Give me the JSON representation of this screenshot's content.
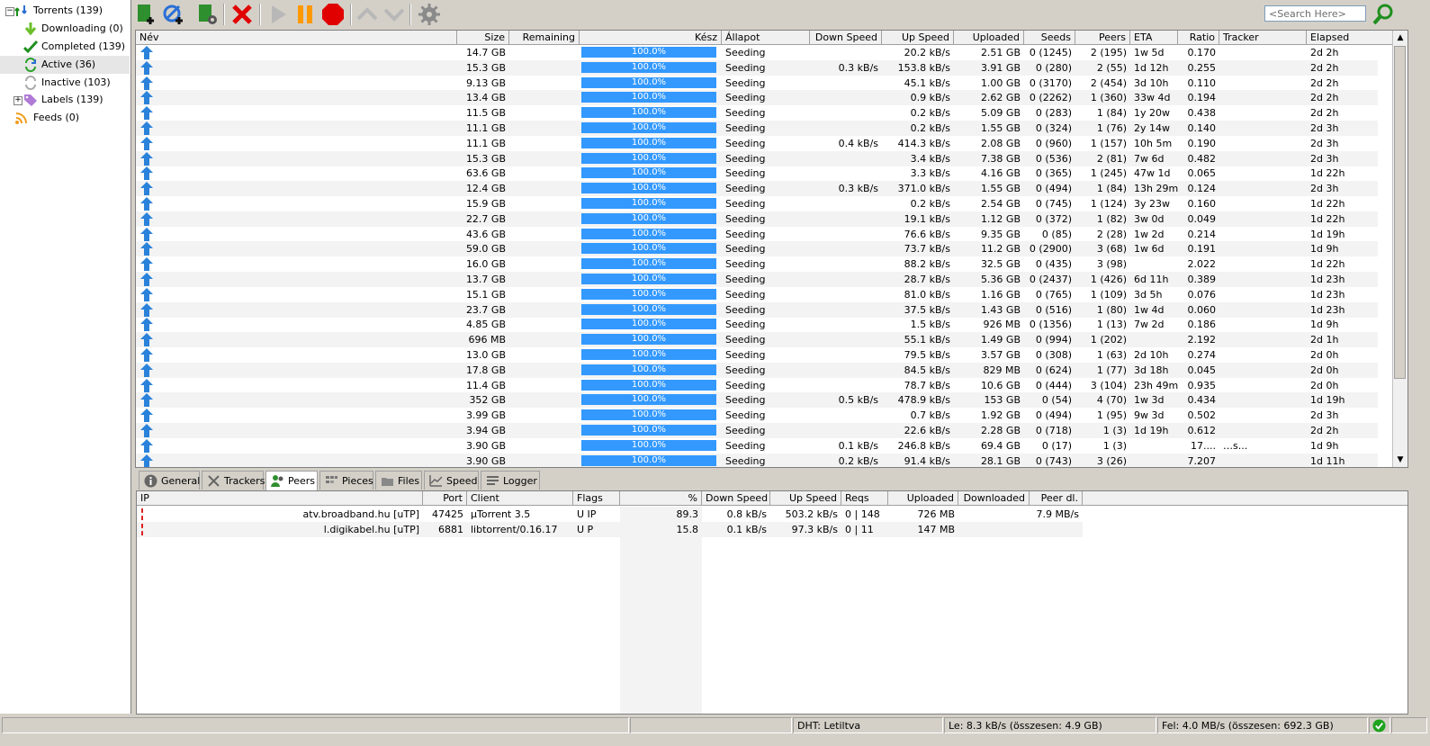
{
  "sidebar": {
    "items": [
      {
        "label": "Torrents (139)",
        "icon": "torrents-icon"
      },
      {
        "label": "Downloading (0)",
        "icon": "download-arrow-icon"
      },
      {
        "label": "Completed (139)",
        "icon": "checkmark-icon"
      },
      {
        "label": "Active (36)",
        "icon": "refresh-icon"
      },
      {
        "label": "Inactive (103)",
        "icon": "refresh-gray-icon"
      },
      {
        "label": "Labels (139)",
        "icon": "tag-icon"
      },
      {
        "label": "Feeds (0)",
        "icon": "rss-icon"
      }
    ]
  },
  "toolbar": {
    "search_placeholder": "<Search Here>",
    "buttons": [
      "add-torrent",
      "add-url",
      "create-torrent",
      "remove",
      "start",
      "pause",
      "stop",
      "move-up",
      "move-down",
      "preferences"
    ]
  },
  "list": {
    "columns": [
      "Név",
      "Size",
      "Remaining",
      "Kész",
      "Állapot",
      "Down Speed",
      "Up Speed",
      "Uploaded",
      "Seeds",
      "Peers",
      "ETA",
      "Ratio",
      "Tracker",
      "Elapsed"
    ],
    "rows": [
      {
        "size": "14.7 GB",
        "done": "100.0%",
        "status": "Seeding",
        "down": "",
        "up": "20.2 kB/s",
        "uploaded": "2.51 GB",
        "seeds": "0 (1245)",
        "peers": "2 (195)",
        "eta": "1w 5d",
        "ratio": "0.170",
        "tracker": "",
        "elapsed": "2d 2h"
      },
      {
        "size": "15.3 GB",
        "done": "100.0%",
        "status": "Seeding",
        "down": "0.3 kB/s",
        "up": "153.8 kB/s",
        "uploaded": "3.91 GB",
        "seeds": "0 (280)",
        "peers": "2 (55)",
        "eta": "1d 12h",
        "ratio": "0.255",
        "tracker": "",
        "elapsed": "2d 2h"
      },
      {
        "size": "9.13 GB",
        "done": "100.0%",
        "status": "Seeding",
        "down": "",
        "up": "45.1 kB/s",
        "uploaded": "1.00 GB",
        "seeds": "0 (3170)",
        "peers": "2 (454)",
        "eta": "3d 10h",
        "ratio": "0.110",
        "tracker": "",
        "elapsed": "2d 2h"
      },
      {
        "size": "13.4 GB",
        "done": "100.0%",
        "status": "Seeding",
        "down": "",
        "up": "0.9 kB/s",
        "uploaded": "2.62 GB",
        "seeds": "0 (2262)",
        "peers": "1 (360)",
        "eta": "33w 4d",
        "ratio": "0.194",
        "tracker": "",
        "elapsed": "2d 2h"
      },
      {
        "size": "11.5 GB",
        "done": "100.0%",
        "status": "Seeding",
        "down": "",
        "up": "0.2 kB/s",
        "uploaded": "5.09 GB",
        "seeds": "0 (283)",
        "peers": "1 (84)",
        "eta": "1y 20w",
        "ratio": "0.438",
        "tracker": "",
        "elapsed": "2d 2h"
      },
      {
        "size": "11.1 GB",
        "done": "100.0%",
        "status": "Seeding",
        "down": "",
        "up": "0.2 kB/s",
        "uploaded": "1.55 GB",
        "seeds": "0 (324)",
        "peers": "1 (76)",
        "eta": "2y 14w",
        "ratio": "0.140",
        "tracker": "",
        "elapsed": "2d 3h"
      },
      {
        "size": "11.1 GB",
        "done": "100.0%",
        "status": "Seeding",
        "down": "0.4 kB/s",
        "up": "414.3 kB/s",
        "uploaded": "2.08 GB",
        "seeds": "0 (960)",
        "peers": "1 (157)",
        "eta": "10h 5m",
        "ratio": "0.190",
        "tracker": "",
        "elapsed": "2d 3h"
      },
      {
        "size": "15.3 GB",
        "done": "100.0%",
        "status": "Seeding",
        "down": "",
        "up": "3.4 kB/s",
        "uploaded": "7.38 GB",
        "seeds": "0 (536)",
        "peers": "2 (81)",
        "eta": "7w 6d",
        "ratio": "0.482",
        "tracker": "",
        "elapsed": "2d 3h"
      },
      {
        "size": "63.6 GB",
        "done": "100.0%",
        "status": "Seeding",
        "down": "",
        "up": "3.3 kB/s",
        "uploaded": "4.16 GB",
        "seeds": "0 (365)",
        "peers": "1 (245)",
        "eta": "47w 1d",
        "ratio": "0.065",
        "tracker": "",
        "elapsed": "1d 22h"
      },
      {
        "size": "12.4 GB",
        "done": "100.0%",
        "status": "Seeding",
        "down": "0.3 kB/s",
        "up": "371.0 kB/s",
        "uploaded": "1.55 GB",
        "seeds": "0 (494)",
        "peers": "1 (84)",
        "eta": "13h 29m",
        "ratio": "0.124",
        "tracker": "",
        "elapsed": "2d 3h"
      },
      {
        "size": "15.9 GB",
        "done": "100.0%",
        "status": "Seeding",
        "down": "",
        "up": "0.2 kB/s",
        "uploaded": "2.54 GB",
        "seeds": "0 (745)",
        "peers": "1 (124)",
        "eta": "3y 23w",
        "ratio": "0.160",
        "tracker": "",
        "elapsed": "1d 22h"
      },
      {
        "size": "22.7 GB",
        "done": "100.0%",
        "status": "Seeding",
        "down": "",
        "up": "19.1 kB/s",
        "uploaded": "1.12 GB",
        "seeds": "0 (372)",
        "peers": "1 (82)",
        "eta": "3w 0d",
        "ratio": "0.049",
        "tracker": "",
        "elapsed": "1d 22h"
      },
      {
        "size": "43.6 GB",
        "done": "100.0%",
        "status": "Seeding",
        "down": "",
        "up": "76.6 kB/s",
        "uploaded": "9.35 GB",
        "seeds": "0 (85)",
        "peers": "2 (28)",
        "eta": "1w 2d",
        "ratio": "0.214",
        "tracker": "",
        "elapsed": "1d 19h"
      },
      {
        "size": "59.0 GB",
        "done": "100.0%",
        "status": "Seeding",
        "down": "",
        "up": "73.7 kB/s",
        "uploaded": "11.2 GB",
        "seeds": "0 (2900)",
        "peers": "3 (68)",
        "eta": "1w 6d",
        "ratio": "0.191",
        "tracker": "",
        "elapsed": "1d 9h"
      },
      {
        "size": "16.0 GB",
        "done": "100.0%",
        "status": "Seeding",
        "down": "",
        "up": "88.2 kB/s",
        "uploaded": "32.5 GB",
        "seeds": "0 (435)",
        "peers": "3 (98)",
        "eta": "",
        "ratio": "2.022",
        "tracker": "",
        "elapsed": "1d 22h"
      },
      {
        "size": "13.7 GB",
        "done": "100.0%",
        "status": "Seeding",
        "down": "",
        "up": "28.7 kB/s",
        "uploaded": "5.36 GB",
        "seeds": "0 (2437)",
        "peers": "1 (426)",
        "eta": "6d 11h",
        "ratio": "0.389",
        "tracker": "",
        "elapsed": "1d 23h"
      },
      {
        "size": "15.1 GB",
        "done": "100.0%",
        "status": "Seeding",
        "down": "",
        "up": "81.0 kB/s",
        "uploaded": "1.16 GB",
        "seeds": "0 (765)",
        "peers": "1 (109)",
        "eta": "3d 5h",
        "ratio": "0.076",
        "tracker": "",
        "elapsed": "1d 23h"
      },
      {
        "size": "23.7 GB",
        "done": "100.0%",
        "status": "Seeding",
        "down": "",
        "up": "37.5 kB/s",
        "uploaded": "1.43 GB",
        "seeds": "0 (516)",
        "peers": "1 (80)",
        "eta": "1w 4d",
        "ratio": "0.060",
        "tracker": "",
        "elapsed": "1d 23h"
      },
      {
        "size": "4.85 GB",
        "done": "100.0%",
        "status": "Seeding",
        "down": "",
        "up": "1.5 kB/s",
        "uploaded": "926 MB",
        "seeds": "0 (1356)",
        "peers": "1 (13)",
        "eta": "7w 2d",
        "ratio": "0.186",
        "tracker": "",
        "elapsed": "1d 9h"
      },
      {
        "size": "696 MB",
        "done": "100.0%",
        "status": "Seeding",
        "down": "",
        "up": "55.1 kB/s",
        "uploaded": "1.49 GB",
        "seeds": "0 (994)",
        "peers": "1 (202)",
        "eta": "",
        "ratio": "2.192",
        "tracker": "",
        "elapsed": "2d 1h"
      },
      {
        "size": "13.0 GB",
        "done": "100.0%",
        "status": "Seeding",
        "down": "",
        "up": "79.5 kB/s",
        "uploaded": "3.57 GB",
        "seeds": "0 (308)",
        "peers": "1 (63)",
        "eta": "2d 10h",
        "ratio": "0.274",
        "tracker": "",
        "elapsed": "2d 0h"
      },
      {
        "size": "17.8 GB",
        "done": "100.0%",
        "status": "Seeding",
        "down": "",
        "up": "84.5 kB/s",
        "uploaded": "829 MB",
        "seeds": "0 (624)",
        "peers": "1 (77)",
        "eta": "3d 18h",
        "ratio": "0.045",
        "tracker": "",
        "elapsed": "2d 0h"
      },
      {
        "size": "11.4 GB",
        "done": "100.0%",
        "status": "Seeding",
        "down": "",
        "up": "78.7 kB/s",
        "uploaded": "10.6 GB",
        "seeds": "0 (444)",
        "peers": "3 (104)",
        "eta": "23h 49m",
        "ratio": "0.935",
        "tracker": "",
        "elapsed": "2d 0h"
      },
      {
        "size": "352 GB",
        "done": "100.0%",
        "status": "Seeding",
        "down": "0.5 kB/s",
        "up": "478.9 kB/s",
        "uploaded": "153 GB",
        "seeds": "0 (54)",
        "peers": "4 (70)",
        "eta": "1w 3d",
        "ratio": "0.434",
        "tracker": "",
        "elapsed": "1d 19h"
      },
      {
        "size": "3.99 GB",
        "done": "100.0%",
        "status": "Seeding",
        "down": "",
        "up": "0.7 kB/s",
        "uploaded": "1.92 GB",
        "seeds": "0 (494)",
        "peers": "1 (95)",
        "eta": "9w 3d",
        "ratio": "0.502",
        "tracker": "",
        "elapsed": "2d 3h"
      },
      {
        "size": "3.94 GB",
        "done": "100.0%",
        "status": "Seeding",
        "down": "",
        "up": "22.6 kB/s",
        "uploaded": "2.28 GB",
        "seeds": "0 (718)",
        "peers": "1 (3)",
        "eta": "1d 19h",
        "ratio": "0.612",
        "tracker": "",
        "elapsed": "2d 2h"
      },
      {
        "size": "3.90 GB",
        "done": "100.0%",
        "status": "Seeding",
        "down": "0.1 kB/s",
        "up": "246.8 kB/s",
        "uploaded": "69.4 GB",
        "seeds": "0 (17)",
        "peers": "1 (3)",
        "eta": "",
        "ratio": "17....",
        "tracker": "…s...",
        "elapsed": "1d 9h"
      },
      {
        "size": "3.90 GB",
        "done": "100.0%",
        "status": "Seeding",
        "down": "0.2 kB/s",
        "up": "91.4 kB/s",
        "uploaded": "28.1 GB",
        "seeds": "0 (743)",
        "peers": "3 (26)",
        "eta": "",
        "ratio": "7.207",
        "tracker": "",
        "elapsed": "1d 11h"
      }
    ]
  },
  "tabs": [
    {
      "label": "General",
      "icon": "info-icon"
    },
    {
      "label": "Trackers",
      "icon": "trackers-icon"
    },
    {
      "label": "Peers",
      "icon": "peers-icon"
    },
    {
      "label": "Pieces",
      "icon": "pieces-icon"
    },
    {
      "label": "Files",
      "icon": "files-icon"
    },
    {
      "label": "Speed",
      "icon": "speed-icon"
    },
    {
      "label": "Logger",
      "icon": "logger-icon"
    }
  ],
  "peers": {
    "columns": [
      "IP",
      "Port",
      "Client",
      "Flags",
      "%",
      "Down Speed",
      "Up Speed",
      "Reqs",
      "Uploaded",
      "Downloaded",
      "Peer dl."
    ],
    "rows": [
      {
        "ip": "atv.broadband.hu [uTP]",
        "port": "47425",
        "client": "µTorrent 3.5",
        "flags": "U IP",
        "pct": "89.3",
        "down": "0.8 kB/s",
        "up": "503.2 kB/s",
        "reqs": "0 | 148",
        "uploaded": "726 MB",
        "downloaded": "",
        "peerdl": "7.9 MB/s"
      },
      {
        "ip": "l.digikabel.hu [uTP]",
        "port": "6881",
        "client": "libtorrent/0.16.17",
        "flags": "U P",
        "pct": "15.8",
        "down": "0.1 kB/s",
        "up": "97.3 kB/s",
        "reqs": "0 | 11",
        "uploaded": "147 MB",
        "downloaded": "",
        "peerdl": ""
      }
    ]
  },
  "status": {
    "dht": "DHT: Letiltva",
    "down": "Le: 8.3 kB/s (összesen: 4.9 GB)",
    "up": "Fel: 4.0 MB/s (összesen: 692.3 GB)"
  },
  "colors": {
    "progress": "#3399ff",
    "accent_green": "#1fa31f",
    "red": "#e00000",
    "orange": "#ff9900"
  }
}
